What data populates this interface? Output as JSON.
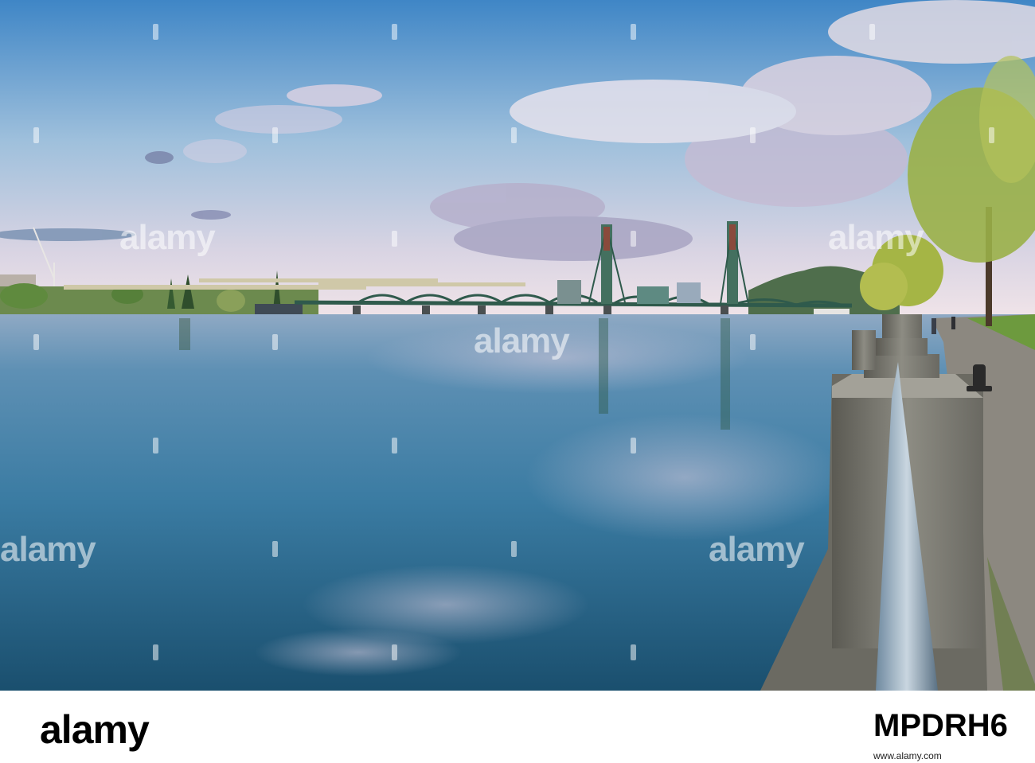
{
  "photo": {
    "subject": "river with steel lift bridge, riverfront promenade railing and trees",
    "watermark_text": "alamy"
  },
  "footer": {
    "logo": "alamy",
    "image_id": "MPDRH6",
    "url": "www.alamy.com"
  },
  "colors": {
    "sky_top": "#4f8fc8",
    "sky_horizon": "#e8dde8",
    "water_dark": "#1f5a78",
    "bridge": "#3e6b5e"
  }
}
